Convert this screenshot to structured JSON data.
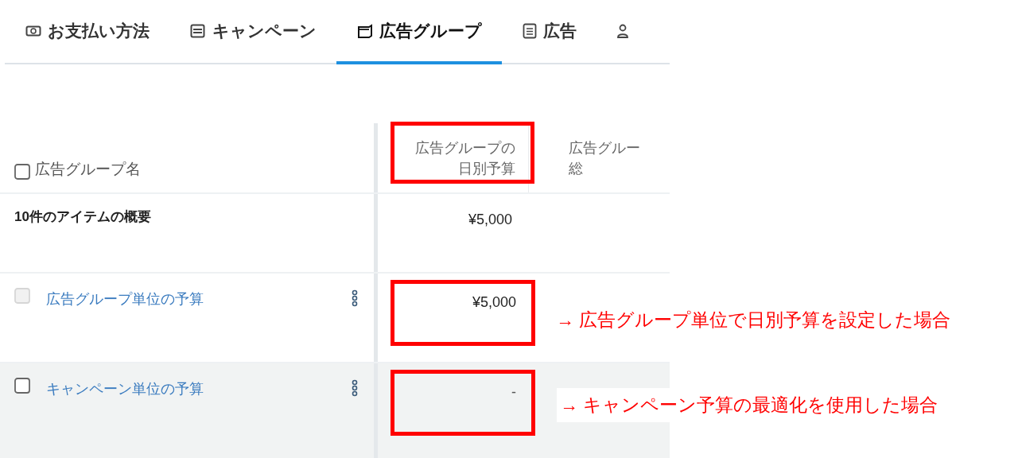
{
  "tabs": [
    {
      "label": "お支払い方法",
      "selected": false
    },
    {
      "label": "キャンペーン",
      "selected": false
    },
    {
      "label": "広告グループ",
      "selected": true
    },
    {
      "label": "広告",
      "selected": false
    },
    {
      "selected": false
    }
  ],
  "table": {
    "header_checkbox": {
      "checked": false
    },
    "columns": [
      {
        "lines": [
          "広告グループ名"
        ]
      },
      {
        "lines": [
          "広告グループの",
          "日別予算"
        ],
        "highlighted": true
      },
      {
        "lines": [
          "広告グルー",
          "総"
        ],
        "highlighted": false
      }
    ],
    "summary": {
      "label": "10件のアイテムの概要",
      "budget": "¥5,000"
    },
    "rows": [
      {
        "name": "広告グループ単位の予算",
        "budget": "¥5,000",
        "checked": false,
        "disabled": true,
        "shaded": false,
        "highlighted": true
      },
      {
        "name": "キャンペーン単位の予算",
        "budget": "-",
        "checked": false,
        "disabled": false,
        "shaded": true,
        "highlighted": true
      }
    ]
  },
  "annotations": [
    {
      "text": "→ 広告グループ単位で日別予算を設定した場合"
    },
    {
      "text": "→ キャンペーン予算の最適化を使用した場合"
    }
  ]
}
